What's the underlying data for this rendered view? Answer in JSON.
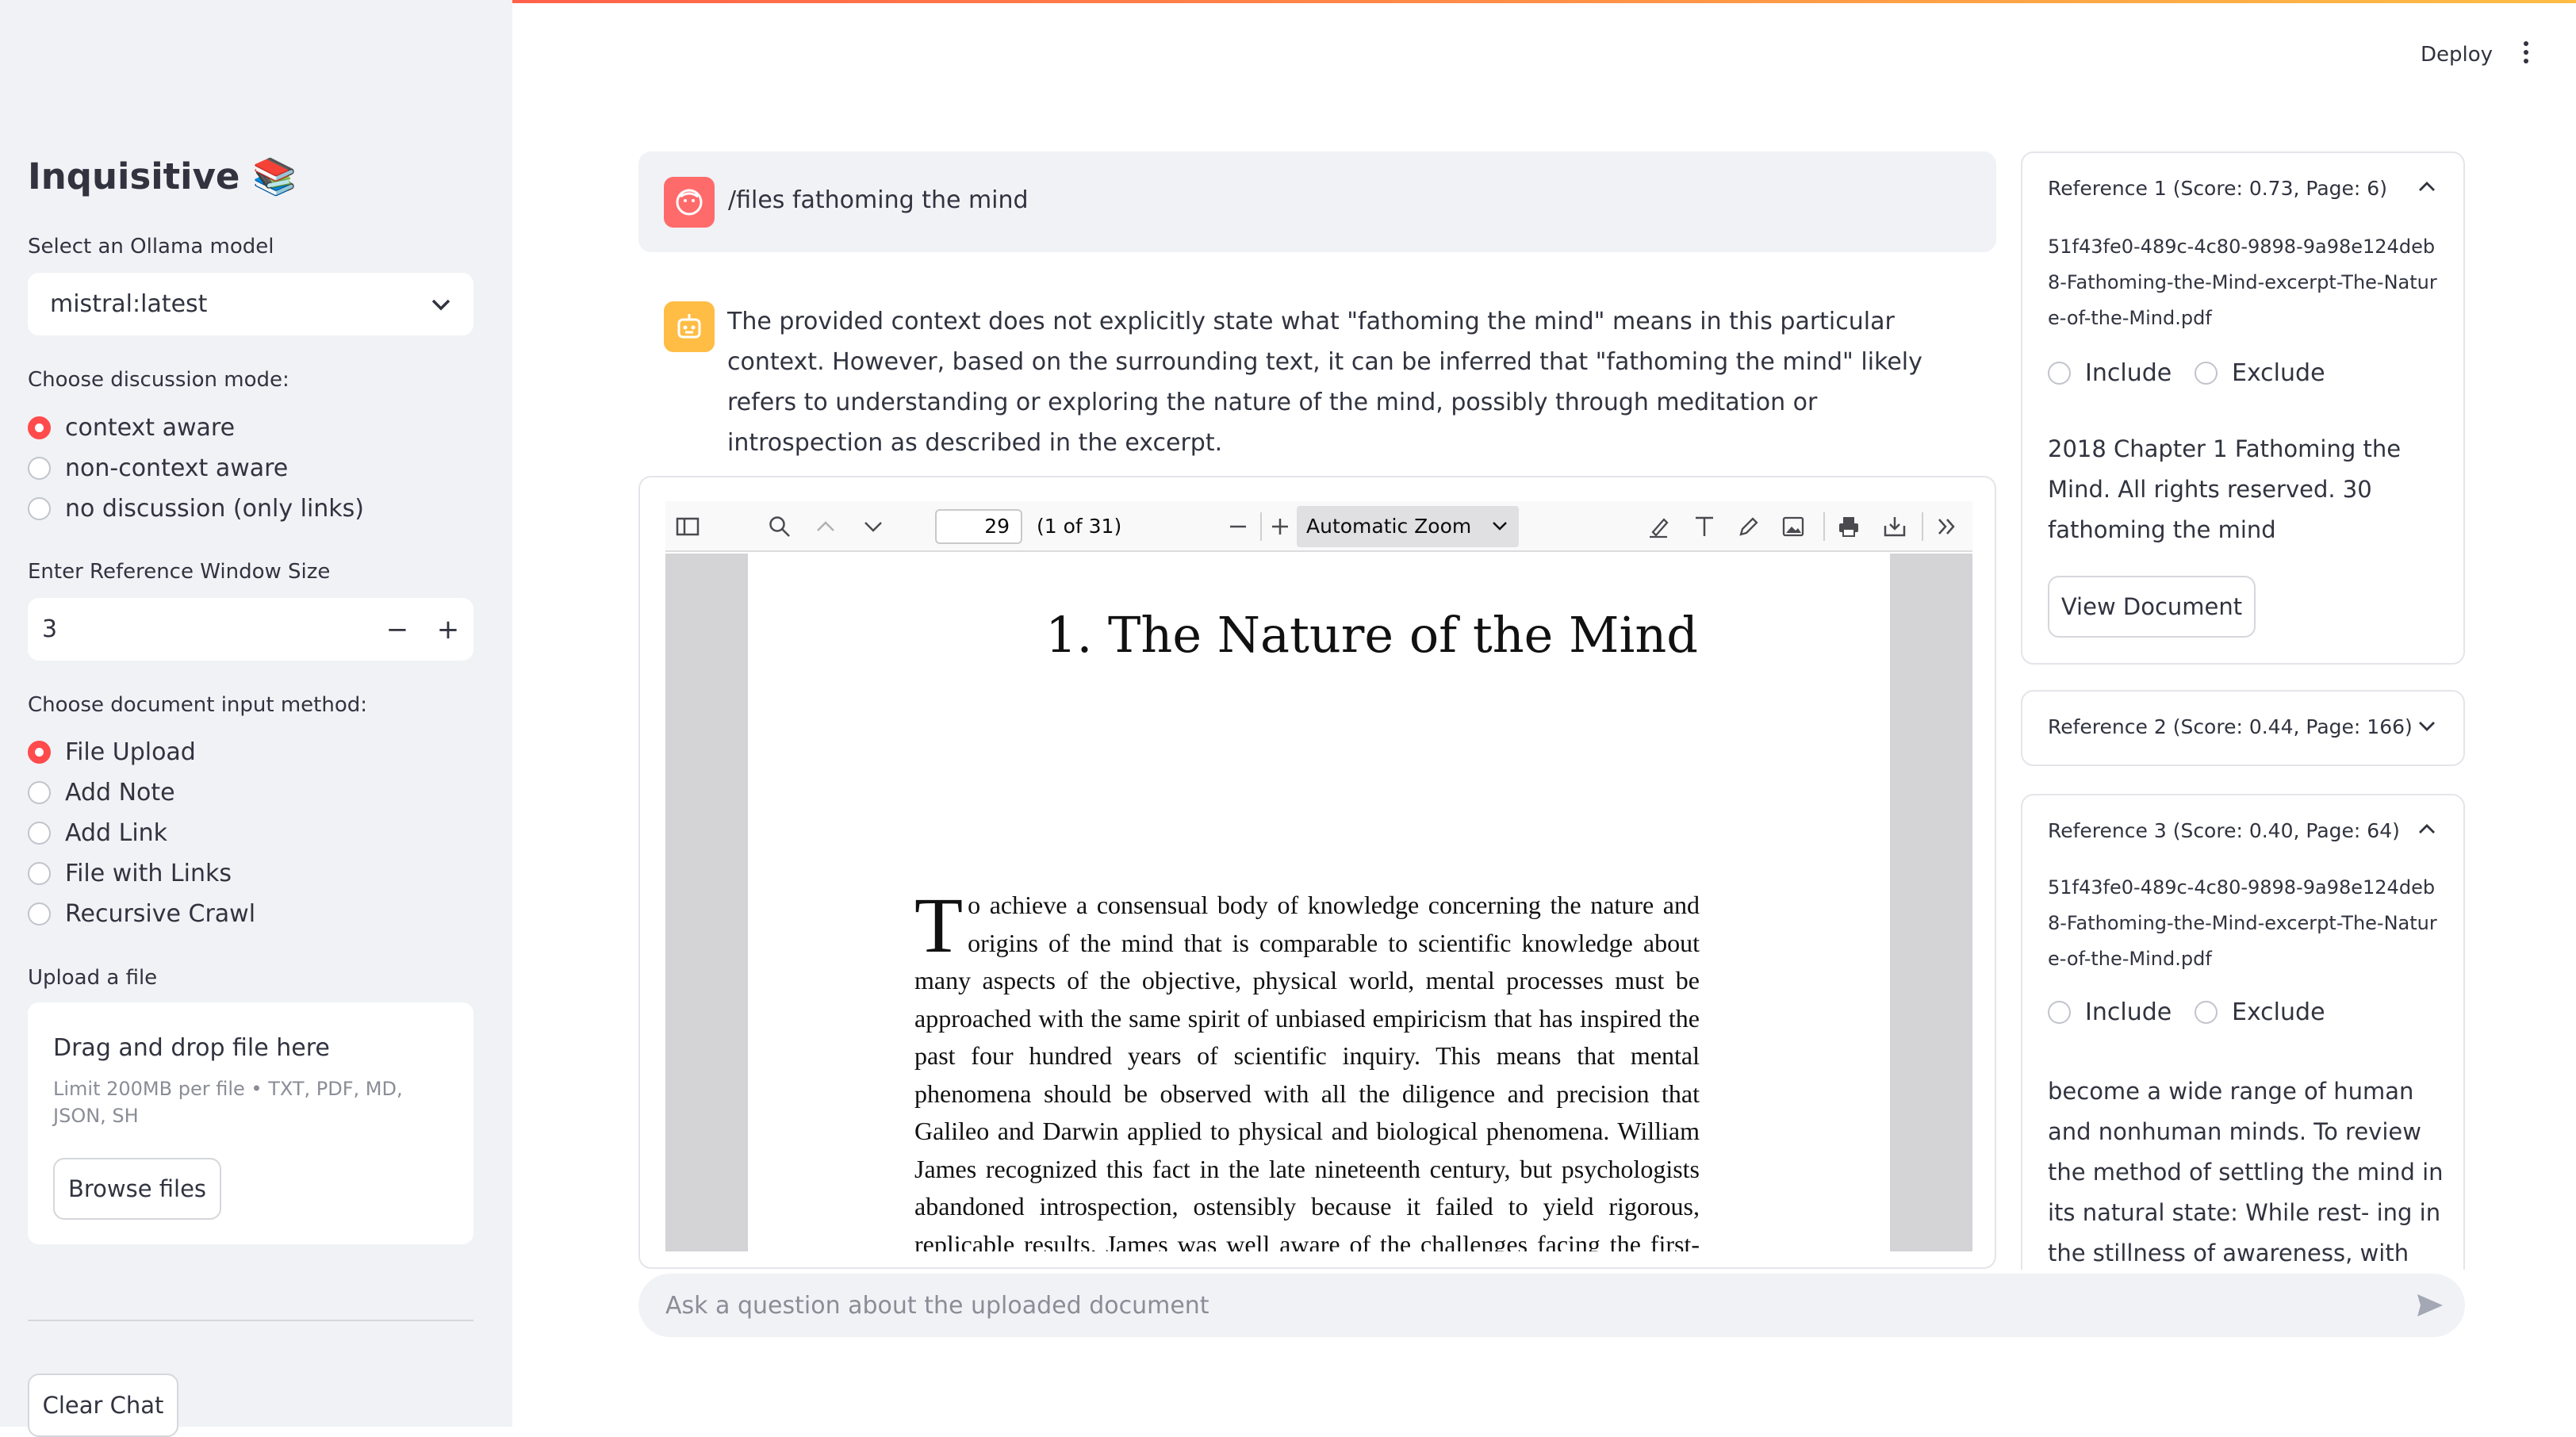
{
  "sidebar": {
    "app_title": "Inquisitive 📚",
    "model_label": "Select an Ollama model",
    "model_value": "mistral:latest",
    "mode_label": "Choose discussion mode:",
    "modes": [
      "context aware",
      "non-context aware",
      "no discussion (only links)"
    ],
    "mode_selected": 0,
    "window_label": "Enter Reference Window Size",
    "window_value": "3",
    "minus": "−",
    "plus": "+",
    "input_method_label": "Choose document input method:",
    "input_methods": [
      "File Upload",
      "Add Note",
      "Add Link",
      "File with Links",
      "Recursive Crawl"
    ],
    "input_method_selected": 0,
    "upload_label": "Upload a file",
    "dropzone_title": "Drag and drop file here",
    "dropzone_hint": "Limit 200MB per file • TXT, PDF, MD, JSON, SH",
    "browse_button": "Browse files",
    "clear_chat": "Clear Chat"
  },
  "header": {
    "deploy": "Deploy"
  },
  "chat": {
    "user_message": "/files fathoming the mind",
    "assistant_message": "The provided context does not explicitly state what \"fathoming the mind\" means in this particular context. However, based on the surrounding text, it can be inferred that \"fathoming the mind\" likely refers to understanding or exploring the nature of the mind, possibly through meditation or introspection as described in the excerpt.",
    "input_placeholder": "Ask a question about the uploaded document"
  },
  "pdf_viewer": {
    "page_number": "29",
    "page_count": "(1 of 31)",
    "zoom": "Automatic Zoom",
    "heading": "1. The Nature of the Mind",
    "dropcap": "T",
    "body": "o achieve a consensual body of knowledge concerning the nature and origins of the mind that is comparable to scientific knowledge about many aspects of the objective, physical world, mental processes must be approached with the same spirit of unbiased empiricism that has inspired the past four hundred years of scientific inquiry. This means that mental phenomena should be observed with all the diligence and precision that Galileo and Darwin applied to physical and biological phenomena. William James recognized this fact in the late nineteenth century, but psychologists abandoned introspection, ostensibly because it failed to yield rigorous, replicable results. James was well aware of the challenges facing the first-person scien-"
  },
  "references": [
    {
      "header": "Reference 1 (Score: 0.73, Page: 6)",
      "expanded": true,
      "filename": "51f43fe0-489c-4c80-9898-9a98e124deb8-Fathoming-the-Mind-excerpt-The-Nature-of-the-Mind.pdf",
      "include": "Include",
      "exclude": "Exclude",
      "snippet": "2018 Chapter 1 Fathoming the Mind. All rights reserved. 30 fathoming the mind",
      "view_button": "View Document"
    },
    {
      "header": "Reference 2 (Score: 0.44, Page: 166)",
      "expanded": false
    },
    {
      "header": "Reference 3 (Score: 0.40, Page: 64)",
      "expanded": true,
      "filename": "51f43fe0-489c-4c80-9898-9a98e124deb8-Fathoming-the-Mind-excerpt-The-Nature-of-the-Mind.pdf",
      "include": "Include",
      "exclude": "Exclude",
      "snippet": "become a wide range of human and nonhuman minds. To review the method of settling the mind in its natural state: While rest- ing in the stillness of awareness, with the eyes"
    }
  ],
  "colors": {
    "accent": "#ff4b4b",
    "sidebar_bg": "#f0f2f6",
    "user_avatar": "#ff6b6b",
    "bot_avatar": "#ffbd45"
  }
}
